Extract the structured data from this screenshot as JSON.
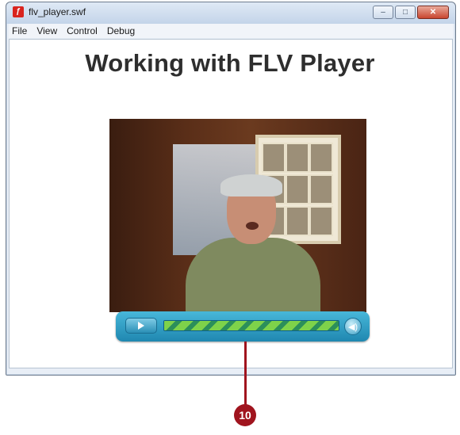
{
  "window": {
    "title": "flv_player.swf",
    "icon": "flash-app-icon",
    "controls": {
      "minimize": "–",
      "maximize": "□",
      "close": "✕"
    }
  },
  "menubar": {
    "items": [
      {
        "label": "File"
      },
      {
        "label": "View"
      },
      {
        "label": "Control"
      },
      {
        "label": "Debug"
      }
    ]
  },
  "stage": {
    "title": "Working with FLV Player"
  },
  "player": {
    "play_icon": "play-icon",
    "volume_icon": "volume-icon",
    "progress": 1.0
  },
  "callout": {
    "number": "10"
  },
  "colors": {
    "callout": "#a0141e",
    "controlbar": "#2f9ec6",
    "seek": "#7ed24a"
  }
}
